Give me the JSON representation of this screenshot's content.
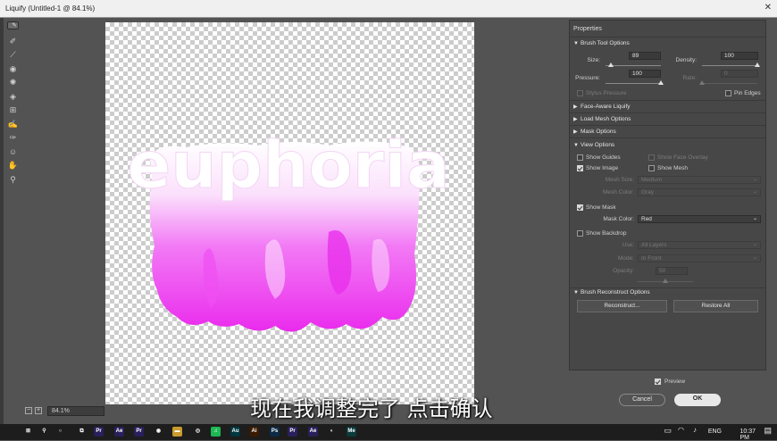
{
  "window": {
    "title": "Liquify (Untitled-1 @ 84.1%)",
    "close_glyph": "✕"
  },
  "tools": [
    {
      "name": "forward-warp-tool",
      "glyph": "✎",
      "selected": true
    },
    {
      "name": "reconstruct-tool",
      "glyph": "✐"
    },
    {
      "name": "smooth-tool",
      "glyph": "⟋"
    },
    {
      "name": "twirl-tool",
      "glyph": "◉"
    },
    {
      "name": "pucker-tool",
      "glyph": "✺"
    },
    {
      "name": "bloat-tool",
      "glyph": "◈"
    },
    {
      "name": "push-left-tool",
      "glyph": "⊞"
    },
    {
      "name": "freeze-mask-tool",
      "glyph": "✍"
    },
    {
      "name": "thaw-mask-tool",
      "glyph": "✑"
    },
    {
      "name": "face-tool",
      "glyph": "☺"
    },
    {
      "name": "hand-tool",
      "glyph": "✋"
    },
    {
      "name": "zoom-tool",
      "glyph": "⚲"
    }
  ],
  "canvas": {
    "artwork_text": "euphoria",
    "accent_color": "#ee3ef0"
  },
  "zoom": {
    "value": "84.1%",
    "minus": "−",
    "plus": "+"
  },
  "caption": "现在我调整完了 点击确认",
  "properties": {
    "title": "Properties",
    "brush_tool_options": {
      "header": "Brush Tool Options",
      "size_label": "Size:",
      "size_value": "89",
      "size_level": 0.1,
      "density_label": "Density:",
      "density_value": "100",
      "density_level": 1.0,
      "pressure_label": "Pressure:",
      "pressure_value": "100",
      "pressure_level": 1.0,
      "rate_label": "Rate:",
      "rate_value": "0",
      "rate_level": 0.0,
      "stylus_pressure_label": "Stylus Pressure",
      "pin_edges_label": "Pin Edges"
    },
    "face_aware_header": "Face-Aware Liquify",
    "load_mesh_header": "Load Mesh Options",
    "mask_options_header": "Mask Options",
    "view_options": {
      "header": "View Options",
      "show_guides": "Show Guides",
      "show_face_overlay": "Show Face Overlay",
      "show_image": "Show Image",
      "show_mesh": "Show Mesh",
      "mesh_size_label": "Mesh Size:",
      "mesh_size_value": "Medium",
      "mesh_color_label": "Mesh Color:",
      "mesh_color_value": "Gray",
      "show_mask": "Show Mask",
      "mask_color_label": "Mask Color:",
      "mask_color_value": "Red",
      "show_backdrop": "Show Backdrop",
      "use_label": "Use:",
      "use_value": "All Layers",
      "mode_label": "Mode:",
      "mode_value": "In Front",
      "opacity_label": "Opacity:",
      "opacity_value": "50",
      "opacity_level": 0.5
    },
    "brush_reconstruct": {
      "header": "Brush Reconstruct Options",
      "reconstruct_button": "Reconstruct...",
      "restore_all_button": "Restore All"
    }
  },
  "footer": {
    "preview_label": "Preview",
    "cancel_label": "Cancel",
    "ok_label": "OK"
  },
  "taskbar": {
    "apps": [
      {
        "name": "start-icon",
        "glyph": "⊞",
        "color": "#1d1d1d"
      },
      {
        "name": "search-icon",
        "glyph": "⚲",
        "color": "#1d1d1d"
      },
      {
        "name": "cortana-icon",
        "glyph": "○",
        "color": "#1d1d1d"
      },
      {
        "name": "task-view-icon",
        "glyph": "⧉",
        "color": "#1d1d1d"
      },
      {
        "name": "premiere-icon",
        "glyph": "Pr",
        "color": "#2a1f5c"
      },
      {
        "name": "after-effects-icon",
        "glyph": "Ae",
        "color": "#2a1f5c"
      },
      {
        "name": "premiere-icon-2",
        "glyph": "Pr",
        "color": "#2a1f5c"
      },
      {
        "name": "chrome-icon",
        "glyph": "◉",
        "color": "#1d1d1d"
      },
      {
        "name": "folder-icon",
        "glyph": "▬",
        "color": "#c99a2e"
      },
      {
        "name": "app-icon",
        "glyph": "◎",
        "color": "#1d1d1d"
      },
      {
        "name": "spotify-icon",
        "glyph": "♫",
        "color": "#1db954"
      },
      {
        "name": "audition-icon",
        "glyph": "Au",
        "color": "#00363f"
      },
      {
        "name": "illustrator-icon",
        "glyph": "Ai",
        "color": "#3a1a00"
      },
      {
        "name": "photoshop-icon",
        "glyph": "Ps",
        "color": "#0c2a45"
      },
      {
        "name": "premiere-icon-3",
        "glyph": "Pr",
        "color": "#2a1f5c"
      },
      {
        "name": "after-effects-icon-2",
        "glyph": "Ae",
        "color": "#2a1f5c"
      },
      {
        "name": "firefox-icon",
        "glyph": "◐",
        "color": "#1d1d1d"
      },
      {
        "name": "media-encoder-icon",
        "glyph": "Me",
        "color": "#0b3b3b"
      }
    ],
    "tray": {
      "lang": "ENG",
      "time": "10:37 PM"
    }
  }
}
